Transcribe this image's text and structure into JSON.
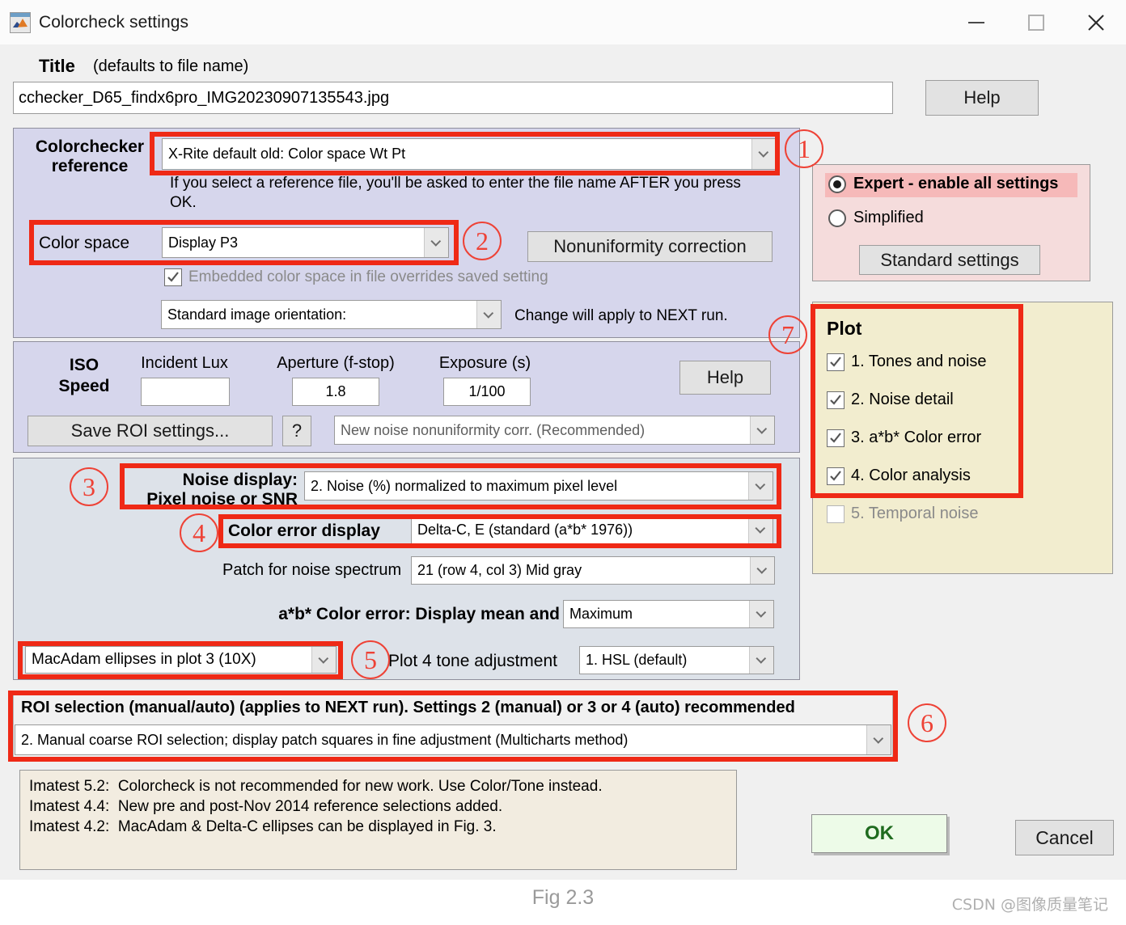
{
  "window": {
    "title": "Colorcheck settings",
    "app_icon": "matlab-figure-icon",
    "controls": {
      "minimize": "minimize-icon",
      "maximize": "maximize-icon",
      "close": "close-icon"
    }
  },
  "title_section": {
    "label": "Title",
    "hint": "(defaults to file name)",
    "value": "cchecker_D65_findx6pro_IMG20230907135543.jpg",
    "help_label": "Help"
  },
  "reference_panel": {
    "label_line1": "Colorchecker",
    "label_line2": "reference",
    "reference_value": "X-Rite default old: Color space Wt Pt",
    "note": "If you select a reference file, you'll be asked to enter the file name AFTER you press\nOK.",
    "colorspace_label": "Color space",
    "colorspace_value": "Display P3",
    "nonuniformity_label": "Nonuniformity correction",
    "embedded_checkbox": "Embedded color space in file overrides saved setting",
    "orientation_value": "Standard image orientation:",
    "orientation_note": "Change will apply to NEXT run."
  },
  "iso_panel": {
    "iso_label_line1": "ISO",
    "iso_label_line2": "Speed",
    "incident_lux_label": "Incident Lux",
    "incident_lux_value": "",
    "aperture_label": "Aperture (f-stop)",
    "aperture_value": "1.8",
    "exposure_label": "Exposure (s)",
    "exposure_value": "1/100",
    "help_label": "Help",
    "save_roi_label": "Save ROI settings...",
    "question_label": "?",
    "nonuniformity_corr_value": "New noise nonuniformity corr. (Recommended)"
  },
  "noise_panel": {
    "noise_display_line1": "Noise display:",
    "noise_display_line2": "Pixel noise or SNR",
    "noise_display_value": "2. Noise (%) normalized to maximum pixel level",
    "color_error_label": "Color error display",
    "color_error_value": "Delta-C, E (standard (a*b* 1976))",
    "patch_label": "Patch for noise spectrum",
    "patch_value": "21  (row 4, col 3)  Mid gray",
    "abcolor_label": "a*b* Color error: Display mean and",
    "abcolor_value": "Maximum",
    "macadam_value": "MacAdam ellipses in plot 3 (10X)",
    "plot4_label": "Plot 4 tone adjustment",
    "plot4_value": "1. HSL (default)"
  },
  "roi_panel": {
    "header": "ROI selection (manual/auto) (applies to NEXT run). Settings 2 (manual) or 3 or 4 (auto) recommended",
    "value": "2. Manual coarse ROI selection; display patch squares in fine adjustment (Multicharts method)"
  },
  "notes_panel": {
    "lines": [
      "Imatest 5.2:  Colorcheck is not recommended for new work. Use Color/Tone instead.",
      "Imatest 4.4:  New pre and post-Nov 2014 reference selections added.",
      "Imatest 4.2:  MacAdam & Delta-C ellipses can be displayed in Fig. 3."
    ]
  },
  "mode_panel": {
    "expert_label": "Expert - enable all settings",
    "expert_selected": true,
    "simplified_label": "Simplified",
    "simplified_selected": false,
    "standard_settings_label": "Standard settings",
    "highlight_color": "#f6b9b9"
  },
  "plot_panel": {
    "title": "Plot",
    "background": "#f2edcf",
    "items": [
      {
        "label": "1. Tones and noise",
        "checked": true,
        "enabled": true
      },
      {
        "label": "2. Noise detail",
        "checked": true,
        "enabled": true
      },
      {
        "label": "3. a*b* Color error",
        "checked": true,
        "enabled": true
      },
      {
        "label": "4. Color analysis",
        "checked": true,
        "enabled": true
      },
      {
        "label": "5. Temporal noise",
        "checked": false,
        "enabled": false
      }
    ]
  },
  "footer": {
    "ok_label": "OK",
    "cancel_label": "Cancel"
  },
  "annotations": {
    "accent_color": "#ef2916",
    "numbers": [
      "1",
      "2",
      "3",
      "4",
      "5",
      "6",
      "7"
    ]
  },
  "caption": {
    "figure": "Fig 2.3",
    "watermark": "CSDN @图像质量笔记"
  }
}
